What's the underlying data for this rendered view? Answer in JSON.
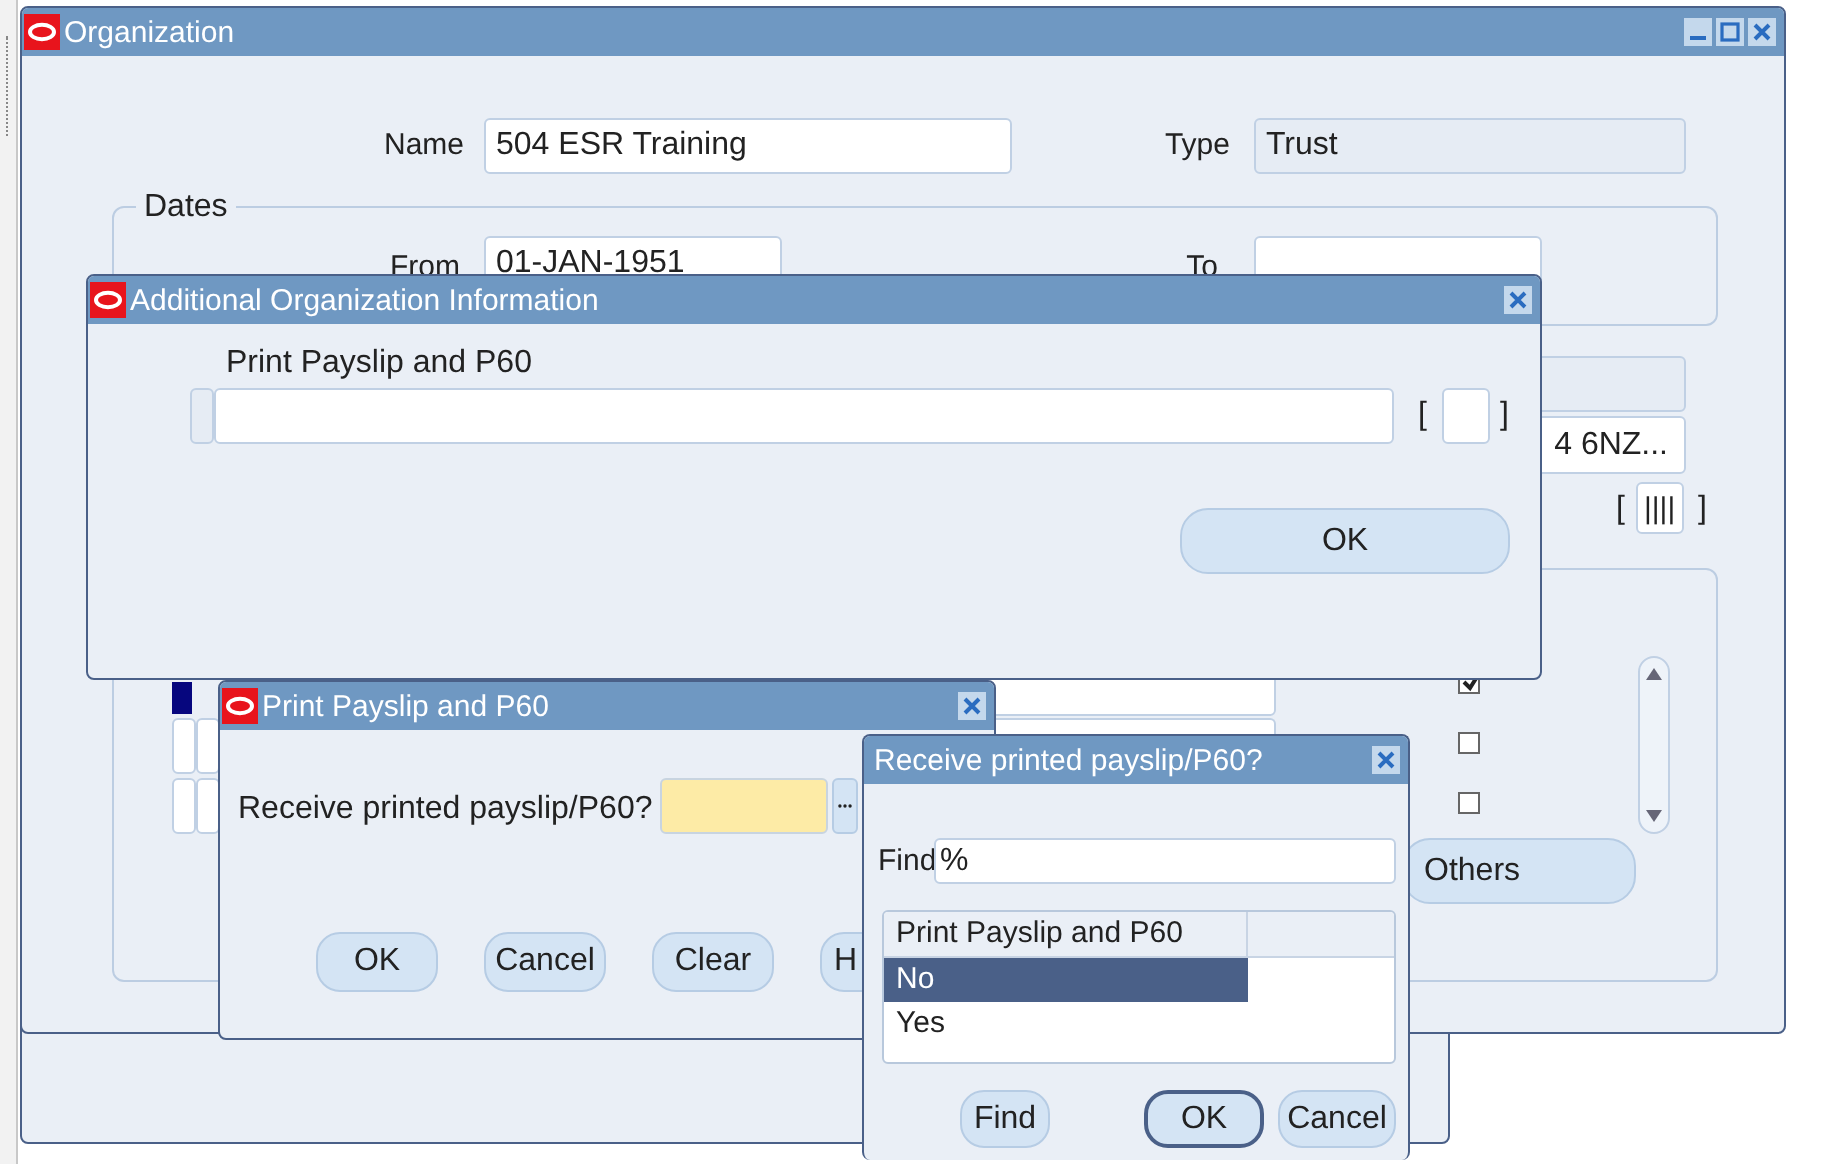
{
  "main_window": {
    "title": "Organization",
    "name_label": "Name",
    "name_value": "504 ESR Training",
    "type_label": "Type",
    "type_value": "Trust",
    "dates_legend": "Dates",
    "from_label": "From",
    "from_value": "01-JAN-1951",
    "to_label": "To",
    "address_value": "4 6NZ...",
    "bracket_open": "[",
    "flex_value": "||||",
    "bracket_close": "]",
    "checkboxes": [
      {
        "checked": true
      },
      {
        "checked": false
      },
      {
        "checked": false
      }
    ],
    "others_button": "Others"
  },
  "additional_info_window": {
    "title": "Additional Organization Information",
    "field_label": "Print Payslip and P60",
    "bracket_open": "[",
    "bracket_close": "]",
    "ok_button": "OK"
  },
  "print_window": {
    "title": "Print Payslip and P60",
    "prompt": "Receive printed payslip/P60?",
    "buttons": [
      "OK",
      "Cancel",
      "Clear",
      "H"
    ]
  },
  "lov_window": {
    "title": "Receive printed payslip/P60?",
    "find_label": "Find",
    "find_value": "%",
    "columns": [
      "Print Payslip and P60"
    ],
    "rows": [
      {
        "value": "No",
        "selected": true
      },
      {
        "value": "Yes",
        "selected": false
      }
    ],
    "buttons": [
      {
        "label": "Find",
        "default": false
      },
      {
        "label": "OK",
        "default": true
      },
      {
        "label": "Cancel",
        "default": false
      }
    ]
  }
}
